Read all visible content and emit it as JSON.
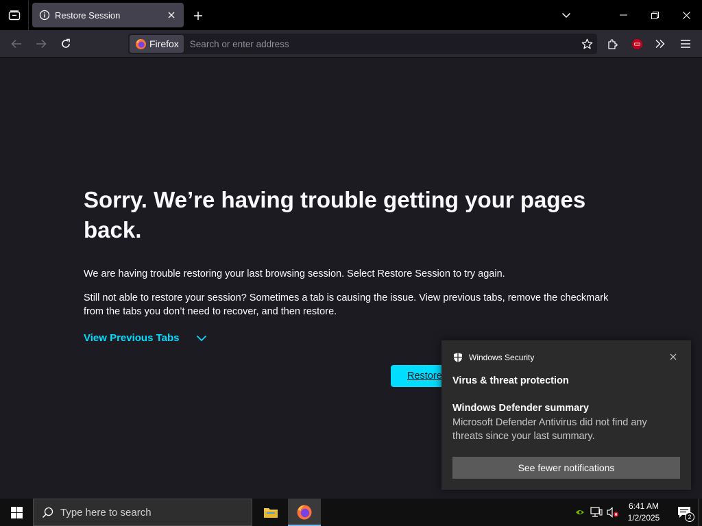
{
  "browser": {
    "tab": {
      "title": "Restore Session",
      "icon": "info-icon"
    },
    "urlbar": {
      "identity_label": "Firefox",
      "placeholder": "Search or enter address"
    },
    "accent": "#00ddff"
  },
  "page": {
    "headline": "Sorry. We’re having trouble getting your pages back.",
    "paragraph1": "We are having trouble restoring your last browsing session. Select Restore Session to try again.",
    "paragraph2": "Still not able to restore your session? Sometimes a tab is causing the issue. View previous tabs, remove the checkmark from the tabs you don’t need to recover, and then restore.",
    "view_previous_tabs": "View Previous Tabs",
    "restore_button_visible_text": "Restore"
  },
  "toast": {
    "app_name": "Windows Security",
    "title": "Virus & threat protection",
    "subtitle": "Windows Defender summary",
    "body": "Microsoft Defender Antivirus did not find any threats since your last summary.",
    "button": "See fewer notifications"
  },
  "taskbar": {
    "search_placeholder": "Type here to search",
    "time": "6:41 AM",
    "date": "1/2/2025",
    "notification_count": "2"
  }
}
